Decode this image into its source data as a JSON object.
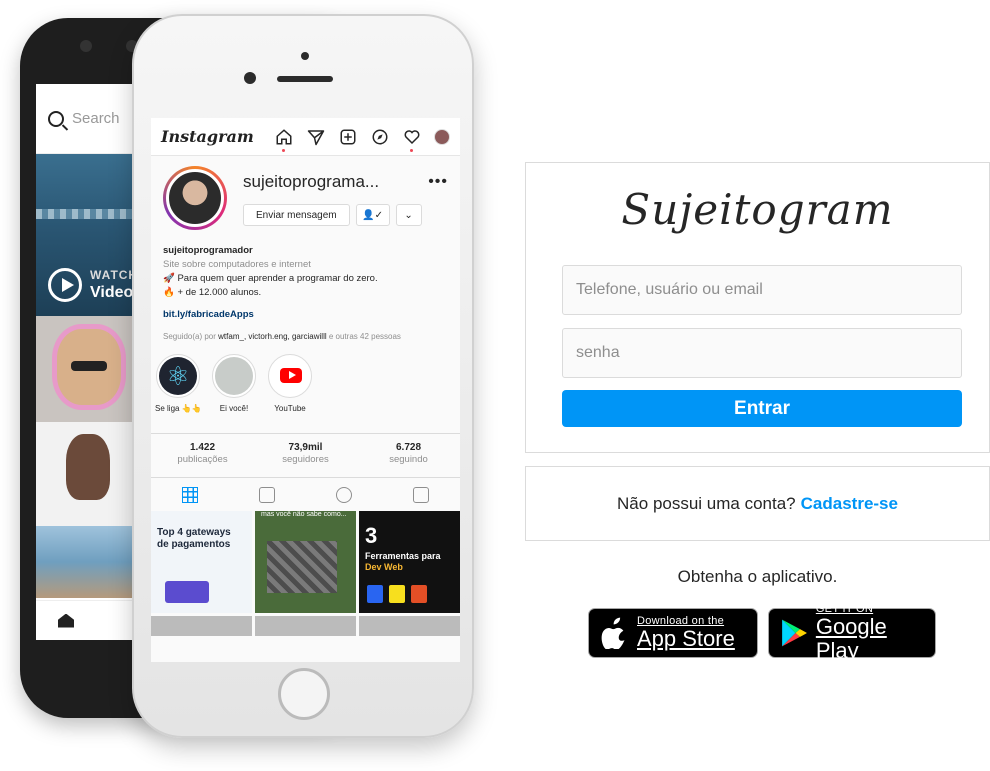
{
  "back_phone": {
    "search_placeholder": "Search",
    "watch_label": "WATCH",
    "video_label": "Video"
  },
  "front_phone": {
    "app_logo": "Instagram",
    "profile": {
      "username": "sujeitoprograma...",
      "message_button": "Enviar mensagem",
      "bio_name": "sujeitoprogramador",
      "bio_category": "Site sobre computadores e internet",
      "bio_line1": "🚀 Para quem quer aprender a programar do zero.",
      "bio_line2": "🔥 + de 12.000 alunos.",
      "bio_link": "bit.ly/fabricadeApps",
      "followed_by_prefix": "Seguido(a) por ",
      "followed_by_names": "wtfam_, victorh.eng, garciawilll",
      "followed_by_suffix": " e outras 42 pessoas"
    },
    "highlights": [
      {
        "label": "Se liga 👆👆",
        "icon": "react-icon"
      },
      {
        "label": "Ei você!",
        "icon": "ei-voce-icon"
      },
      {
        "label": "YouTube",
        "icon": "youtube-icon"
      }
    ],
    "stats": [
      {
        "value": "1.422",
        "label": "publicações"
      },
      {
        "value": "73,9mil",
        "label": "seguidores"
      },
      {
        "value": "6.728",
        "label": "seguindo"
      }
    ],
    "posts": [
      {
        "text": "Top 4 gateways de pagamentos"
      },
      {
        "caption": "mas você não sabe como..."
      },
      {
        "number": "3",
        "title": "Ferramentas para",
        "subtitle": "Dev Web"
      }
    ]
  },
  "login": {
    "brand": "Sujeitogram",
    "user_placeholder": "Telefone, usuário ou email",
    "password_placeholder": "senha",
    "submit_label": "Entrar"
  },
  "signup": {
    "prompt": "Não possui uma conta?",
    "link": "Cadastre-se"
  },
  "get_app": "Obtenha o aplicativo.",
  "stores": {
    "apple_small": "Download on the",
    "apple_big": "App Store",
    "google_small": "GET IT ON",
    "google_big": "Google Play"
  },
  "colors": {
    "accent": "#0095f6",
    "border": "#dbdbdb"
  }
}
